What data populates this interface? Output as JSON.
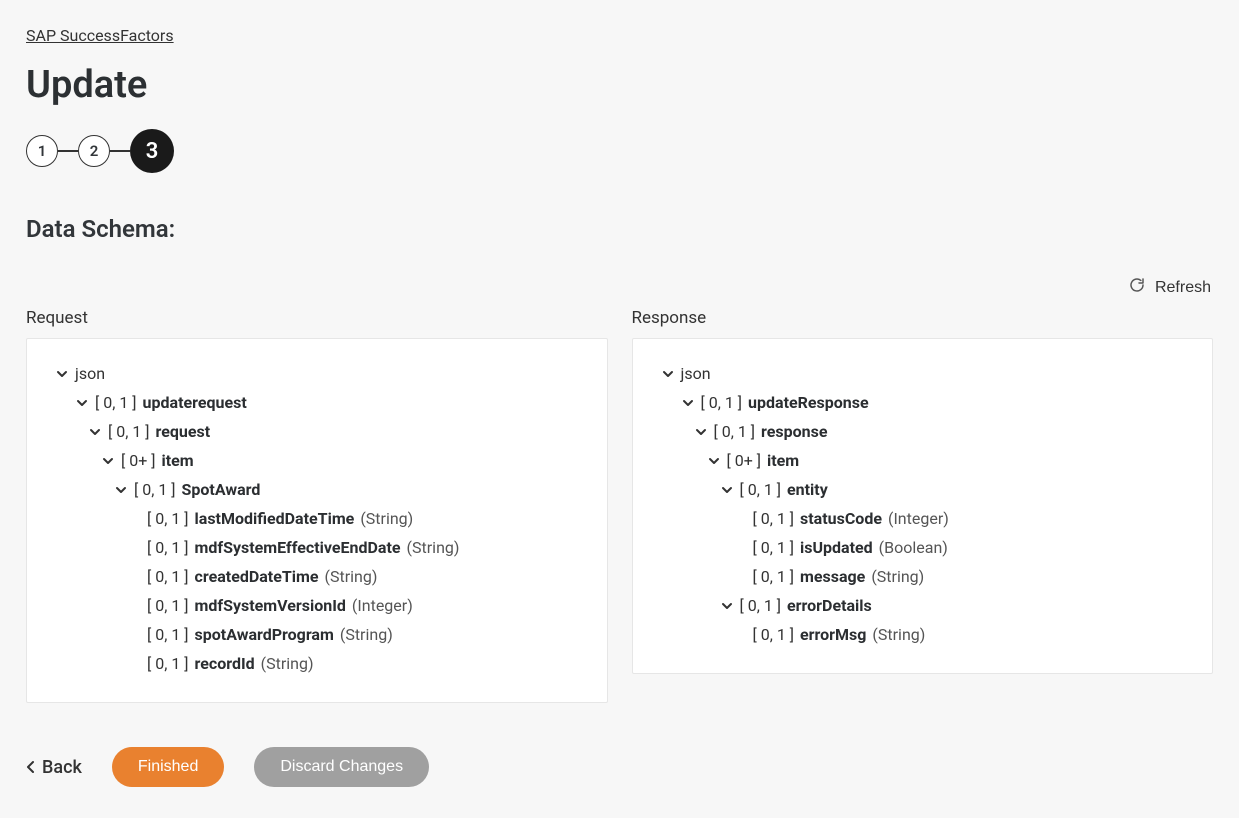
{
  "breadcrumb": {
    "label": "SAP SuccessFactors"
  },
  "page_title": "Update",
  "stepper": {
    "steps": [
      "1",
      "2",
      "3"
    ],
    "active_index": 2
  },
  "section_title": "Data Schema:",
  "refresh": {
    "label": "Refresh"
  },
  "columns": [
    {
      "header": "Request",
      "root": "json",
      "tree": [
        {
          "depth": 0,
          "expandable": true,
          "card": "[ 0, 1 ]",
          "name": "updaterequest"
        },
        {
          "depth": 1,
          "expandable": true,
          "card": "[ 0, 1 ]",
          "name": "request"
        },
        {
          "depth": 2,
          "expandable": true,
          "card": "[ 0+ ]",
          "name": "item"
        },
        {
          "depth": 3,
          "expandable": true,
          "card": "[ 0, 1 ]",
          "name": "SpotAward"
        },
        {
          "depth": 4,
          "expandable": false,
          "card": "[ 0, 1 ]",
          "name": "lastModifiedDateTime",
          "type": "(String)"
        },
        {
          "depth": 4,
          "expandable": false,
          "card": "[ 0, 1 ]",
          "name": "mdfSystemEffectiveEndDate",
          "type": "(String)"
        },
        {
          "depth": 4,
          "expandable": false,
          "card": "[ 0, 1 ]",
          "name": "createdDateTime",
          "type": "(String)"
        },
        {
          "depth": 4,
          "expandable": false,
          "card": "[ 0, 1 ]",
          "name": "mdfSystemVersionId",
          "type": "(Integer)"
        },
        {
          "depth": 4,
          "expandable": false,
          "card": "[ 0, 1 ]",
          "name": "spotAwardProgram",
          "type": "(String)"
        },
        {
          "depth": 4,
          "expandable": false,
          "card": "[ 0, 1 ]",
          "name": "recordId",
          "type": "(String)"
        }
      ]
    },
    {
      "header": "Response",
      "root": "json",
      "tree": [
        {
          "depth": 0,
          "expandable": true,
          "card": "[ 0, 1 ]",
          "name": "updateResponse"
        },
        {
          "depth": 1,
          "expandable": true,
          "card": "[ 0, 1 ]",
          "name": "response"
        },
        {
          "depth": 2,
          "expandable": true,
          "card": "[ 0+ ]",
          "name": "item"
        },
        {
          "depth": 3,
          "expandable": true,
          "card": "[ 0, 1 ]",
          "name": "entity"
        },
        {
          "depth": 4,
          "expandable": false,
          "card": "[ 0, 1 ]",
          "name": "statusCode",
          "type": "(Integer)"
        },
        {
          "depth": 4,
          "expandable": false,
          "card": "[ 0, 1 ]",
          "name": "isUpdated",
          "type": "(Boolean)"
        },
        {
          "depth": 4,
          "expandable": false,
          "card": "[ 0, 1 ]",
          "name": "message",
          "type": "(String)"
        },
        {
          "depth": 3,
          "expandable": true,
          "card": "[ 0, 1 ]",
          "name": "errorDetails"
        },
        {
          "depth": 4,
          "expandable": false,
          "card": "[ 0, 1 ]",
          "name": "errorMsg",
          "type": "(String)"
        }
      ]
    }
  ],
  "footer": {
    "back_label": "Back",
    "primary_label": "Finished",
    "secondary_label": "Discard Changes"
  }
}
